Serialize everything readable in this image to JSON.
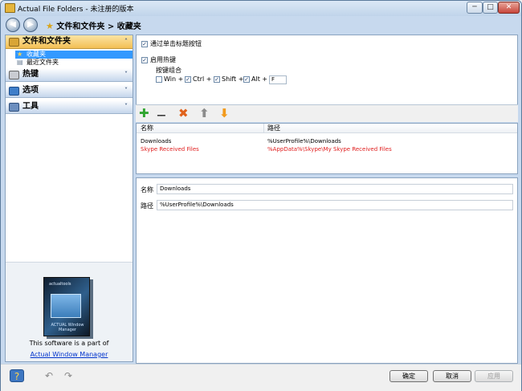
{
  "window": {
    "title": "Actual File Folders - 未注册的版本",
    "min_glyph": "─",
    "max_glyph": "□",
    "close_glyph": "✕"
  },
  "nav": {
    "back_glyph": "◀",
    "forward_glyph": "▶",
    "breadcrumb": "文件和文件夹 > 收藏夹"
  },
  "sidebar": {
    "sections": [
      {
        "label": "文件和文件夹",
        "icon": "folder-files-icon",
        "chevron": "˄",
        "active": true
      },
      {
        "label": "热键",
        "icon": "keyboard-icon",
        "chevron": "˅"
      },
      {
        "label": "选项",
        "icon": "options-icon",
        "chevron": "˅"
      },
      {
        "label": "工具",
        "icon": "tools-icon",
        "chevron": "˅"
      }
    ],
    "items": [
      {
        "label": "收藏夹",
        "icon": "favorites-star-icon",
        "glyph": "★"
      },
      {
        "label": "最近文件夹",
        "icon": "recent-folders-icon",
        "glyph": "▤"
      }
    ],
    "promo": {
      "text": "This software is a part of",
      "link": "Actual Window Manager",
      "box_logo": "actualtools",
      "box_title": "ACTUAL Window Manager"
    }
  },
  "settings": {
    "title_click_label": "通过单击标题按钮",
    "title_click_checked": true,
    "hotkey_enable_label": "启用热键",
    "hotkey_enable_checked": true,
    "hotkey_combo_label": "按键组合",
    "keys": [
      {
        "label": "Win +",
        "checked": false
      },
      {
        "label": "Ctrl +",
        "checked": true
      },
      {
        "label": "Shift +",
        "checked": true
      },
      {
        "label": "Alt +",
        "checked": true
      }
    ],
    "key_value": "F"
  },
  "toolbar": {
    "add_glyph": "✚",
    "remove_glyph": "━━",
    "delete_glyph": "✖",
    "up_glyph": "⬆",
    "down_glyph": "⬇"
  },
  "list": {
    "columns": [
      "名称",
      "路径"
    ],
    "rows": [
      {
        "name": "Downloads",
        "path": "%UserProfile%\\Downloads",
        "error": false
      },
      {
        "name": "Skype Received Files",
        "path": "%AppData%\\Skype\\My Skype Received Files",
        "error": true
      }
    ]
  },
  "detail": {
    "name_label": "名称",
    "name_value": "Downloads",
    "path_label": "路径",
    "path_value": "%UserProfile%\\Downloads"
  },
  "footer": {
    "ok_label": "确定",
    "cancel_label": "取消",
    "apply_label": "应用"
  },
  "colors": {
    "accent": "#3399ff",
    "error_text": "#e02020",
    "active_section": "#f3bf55"
  }
}
